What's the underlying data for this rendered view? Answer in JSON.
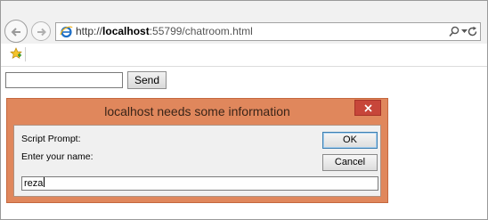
{
  "browser": {
    "url_prefix": "http://",
    "url_host": "localhost",
    "url_rest": ":55799/chatroom.html"
  },
  "page": {
    "message_value": "",
    "send_label": "Send"
  },
  "dialog": {
    "title": "localhost needs some information",
    "label_script_prompt": "Script Prompt:",
    "label_enter_name": "Enter your name:",
    "ok_label": "OK",
    "cancel_label": "Cancel",
    "input_value": "reza"
  },
  "colors": {
    "dialog_frame": "#e0875c",
    "close_button": "#c7463a"
  },
  "icons": [
    "back-arrow-icon",
    "forward-arrow-icon",
    "ie-logo-icon",
    "search-icon",
    "chevron-down-icon",
    "refresh-icon",
    "favorites-star-icon",
    "close-icon"
  ]
}
